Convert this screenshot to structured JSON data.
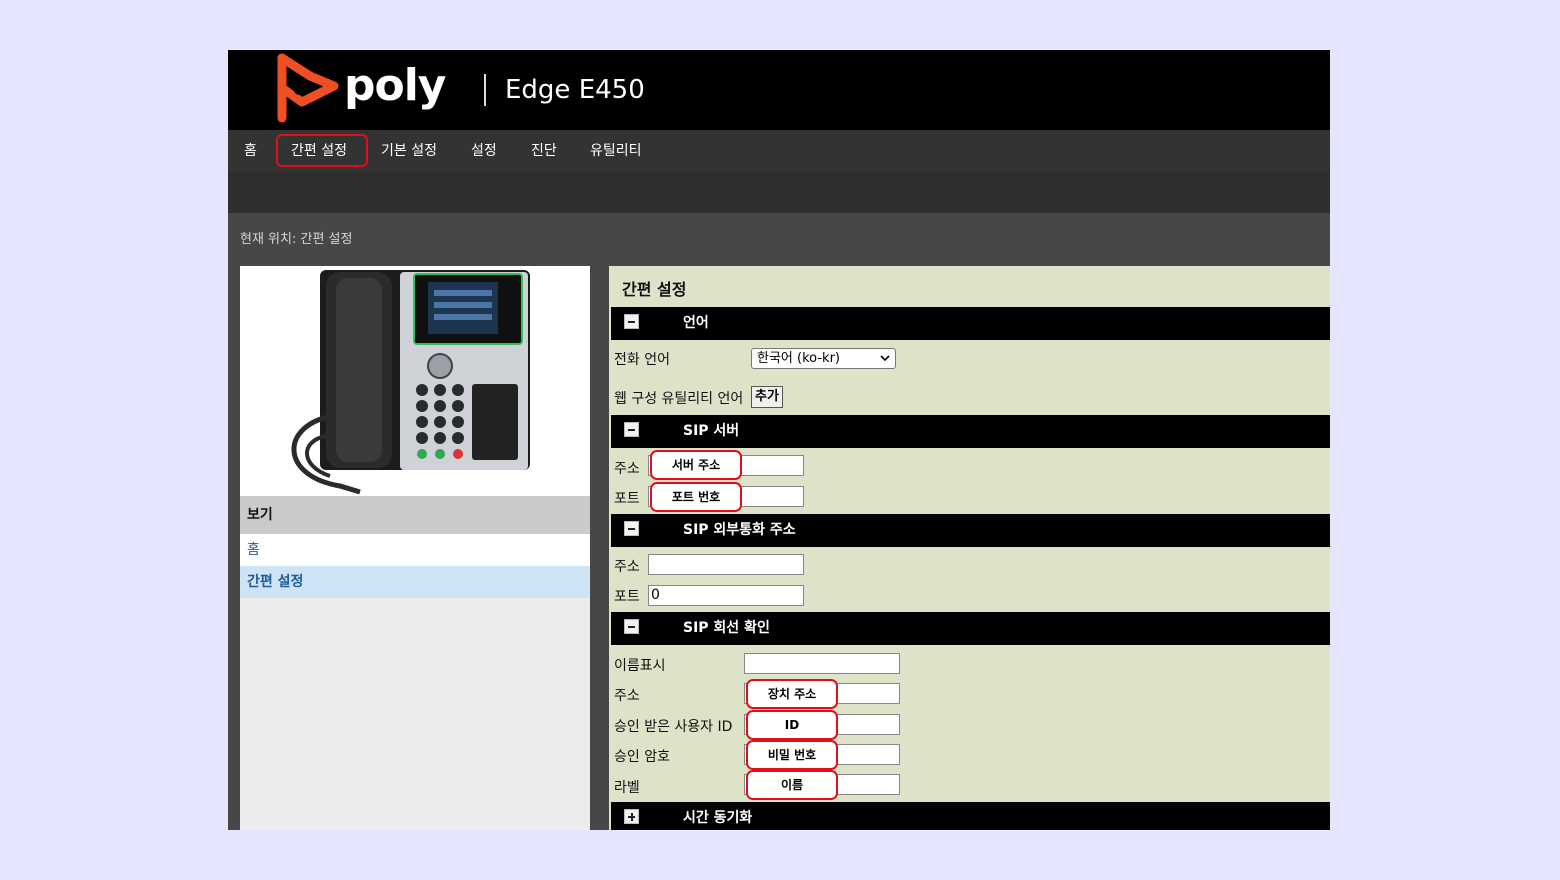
{
  "header": {
    "brand": "poly",
    "model": "Edge E450"
  },
  "nav": {
    "items": [
      "홈",
      "간편 설정",
      "기본 설정",
      "설정",
      "진단",
      "유틸리티"
    ],
    "active_index": 1
  },
  "breadcrumb": "현재 위치: 간편 설정",
  "sidebar": {
    "view_header": "보기",
    "links": [
      "홈",
      "간편 설정"
    ],
    "active_index": 1
  },
  "panel": {
    "title": "간편 설정",
    "language": {
      "title": "언어",
      "phone_language_label": "전화 언어",
      "phone_language_value": "한국어 (ko-kr)",
      "web_language_label": "웹 구성 유틸리티 언어",
      "add_button": "추가"
    },
    "sip_server": {
      "title": "SIP 서버",
      "address_label": "주소",
      "address_callout": "서버 주소",
      "port_label": "포트",
      "port_callout": "포트 번호"
    },
    "sip_outbound": {
      "title": "SIP 외부통화 주소",
      "address_label": "주소",
      "address_value": "",
      "port_label": "포트",
      "port_value": "0"
    },
    "sip_line": {
      "title": "SIP 회선 확인",
      "display_name_label": "이름표시",
      "address_label": "주소",
      "address_callout": "장치 주소",
      "auth_id_label": "승인 받은 사용자 ID",
      "auth_id_callout": "ID",
      "auth_password_label": "승인 암호",
      "auth_password_callout": "비밀 번호",
      "label_label": "라벨",
      "label_callout": "이름"
    },
    "time_sync": {
      "title": "시간 동기화"
    }
  },
  "colors": {
    "brand_orange": "#f04e23",
    "highlight_red": "#e0101a",
    "panel_bg": "#dde3c9",
    "link_blue": "#1f5c99"
  }
}
